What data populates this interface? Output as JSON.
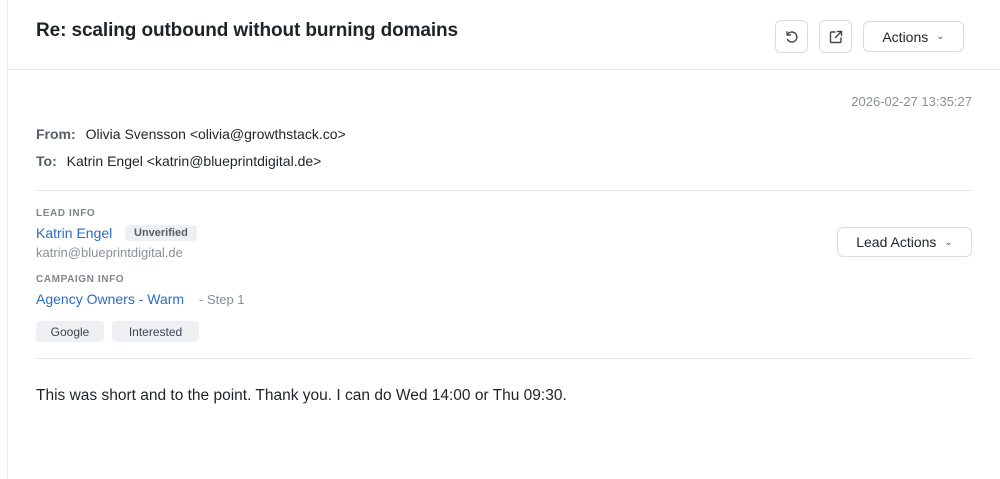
{
  "email": {
    "subject": "Re: scaling outbound without burning domains",
    "timestamp": "2026-02-27 13:35:27",
    "from_label": "From:",
    "from_value": "Olivia Svensson <olivia@growthstack.co>",
    "to_label": "To:",
    "to_value": "Katrin Engel <katrin@blueprintdigital.de>",
    "body": "This was short and to the point. Thank you. I can do Wed 14:00 or Thu 09:30."
  },
  "toolbar": {
    "refresh_icon": "refresh-icon",
    "open_icon": "external-link-icon",
    "actions_label": "Actions",
    "chevron": "⌄"
  },
  "lead": {
    "section_label": "LEAD INFO",
    "name": "Katrin Engel",
    "status_badge": "Unverified",
    "email": "katrin@blueprintdigital.de",
    "actions_label": "Lead Actions"
  },
  "campaign": {
    "section_label": "CAMPAIGN INFO",
    "name": "Agency Owners - Warm",
    "step": "- Step 1"
  },
  "tags": [
    "Google",
    "Interested"
  ],
  "colors": {
    "link": "#2b6cc4",
    "muted": "#8a9099",
    "tag_bg": "#eef0f3",
    "border": "#e6e8eb"
  }
}
